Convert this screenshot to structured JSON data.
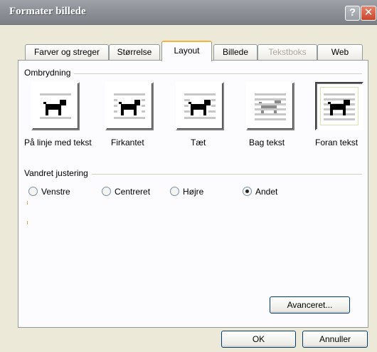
{
  "window": {
    "title": "Formater billede",
    "help_glyph": "?",
    "close_glyph": "✕"
  },
  "tabs": [
    {
      "label": "Farver og streger",
      "state": "normal"
    },
    {
      "label": "Størrelse",
      "state": "normal"
    },
    {
      "label": "Layout",
      "state": "active"
    },
    {
      "label": "Billede",
      "state": "normal"
    },
    {
      "label": "Tekstboks",
      "state": "disabled"
    },
    {
      "label": "Web",
      "state": "normal"
    }
  ],
  "wrapping": {
    "group_label": "Ombrydning",
    "options": [
      {
        "label": "På linje med tekst",
        "icon": "dog-inline-icon",
        "selected": false
      },
      {
        "label": "Firkantet",
        "icon": "dog-square-icon",
        "selected": false
      },
      {
        "label": "Tæt",
        "icon": "dog-tight-icon",
        "selected": false
      },
      {
        "label": "Bag tekst",
        "icon": "dog-behind-text-icon",
        "selected": false
      },
      {
        "label": "Foran tekst",
        "icon": "dog-in-front-of-text-icon",
        "selected": true
      }
    ]
  },
  "alignment": {
    "group_label": "Vandret justering",
    "options": [
      {
        "label": "Venstre",
        "checked": false
      },
      {
        "label": "Centreret",
        "checked": false
      },
      {
        "label": "Højre",
        "checked": false
      },
      {
        "label": "Andet",
        "checked": true
      }
    ]
  },
  "buttons": {
    "advanced": "Avanceret...",
    "ok": "OK",
    "cancel": "Annuller"
  },
  "colors": {
    "titlebar": "#8e9298",
    "active_tab_accent": "#f8b33a",
    "close_button": "#c8462c"
  }
}
